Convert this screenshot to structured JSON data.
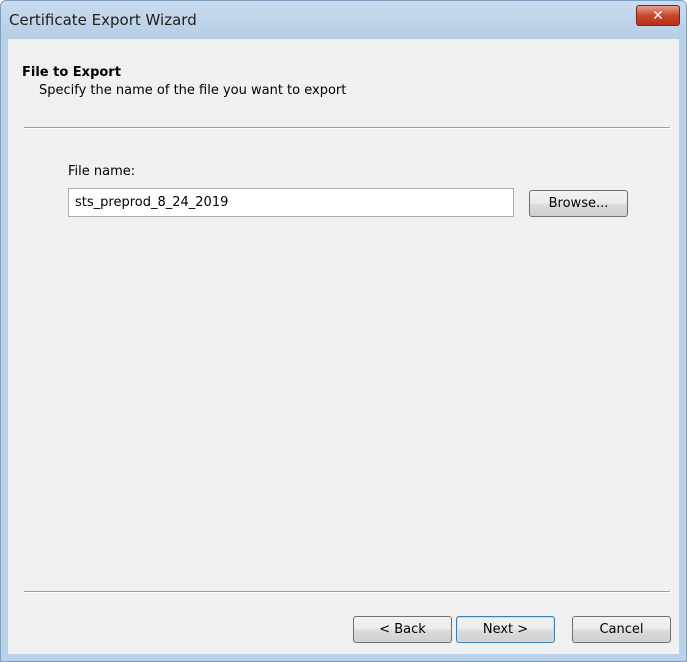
{
  "window": {
    "title": "Certificate Export Wizard",
    "close_glyph": "✕",
    "close_icon": "close-icon"
  },
  "header": {
    "title": "File to Export",
    "subtitle": "Specify the name of the file you want to export"
  },
  "form": {
    "file_name_label": "File name:",
    "file_name_value": "sts_preprod_8_24_2019",
    "browse_label": "Browse..."
  },
  "footer": {
    "back_label": "< Back",
    "next_label": "Next >",
    "cancel_label": "Cancel"
  },
  "colors": {
    "title_bar": "#b9d1ea",
    "client_background": "#f0f0f0",
    "close_button": "#c9462c",
    "default_button_border": "#3c7fb1"
  }
}
